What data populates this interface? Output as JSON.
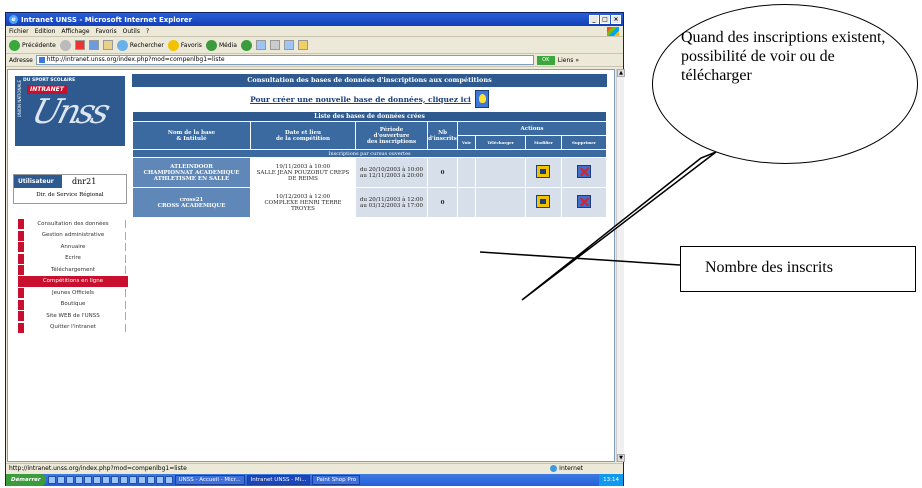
{
  "window": {
    "title": "Intranet UNSS - Microsoft Internet Explorer",
    "controls": [
      "_",
      "□",
      "×"
    ]
  },
  "menu": [
    "Fichier",
    "Edition",
    "Affichage",
    "Favoris",
    "Outils",
    "?"
  ],
  "toolbar": {
    "back": "Précédente",
    "search": "Rechercher",
    "favorites": "Favoris",
    "media": "Média"
  },
  "address": {
    "label": "Adresse",
    "url": "http://intranet.unss.org/index.php?mod=compenlbg1=liste",
    "go": "OK",
    "links": "Liens »"
  },
  "logo": {
    "top_text": "DU SPORT SCOLAIRE",
    "banner": "INTRANET",
    "side_text": "UNION NATIONALE",
    "script": "Unss"
  },
  "user": {
    "label": "Utilisateur",
    "name": "dnr21",
    "role": "Dir. de Service Régional"
  },
  "nav": [
    {
      "label": "Consultation des données",
      "active": false
    },
    {
      "label": "Gestion administrative",
      "active": false
    },
    {
      "label": "Annuaire",
      "active": false
    },
    {
      "label": "Ecrire",
      "active": false
    },
    {
      "label": "Téléchargement",
      "active": false
    },
    {
      "label": "Compétitions en ligne",
      "active": true
    },
    {
      "label": "Jeunes Officiels",
      "active": false
    },
    {
      "label": "Boutique",
      "active": false
    },
    {
      "label": "Site WEB de l'UNSS",
      "active": false
    },
    {
      "label": "Quitter l'intranet",
      "active": false
    }
  ],
  "main": {
    "banner": "Consultation des bases de données d'inscriptions aux compétitions",
    "create_link": "Pour créer une nouvelle base de données, cliquez ici",
    "list_title": "Liste des bases de données crées",
    "headers": {
      "name": [
        "Nom de la base",
        "& Intitulé"
      ],
      "date": [
        "Date et lieu",
        "de la compétition"
      ],
      "period": [
        "Période",
        "d'ouverture",
        "des inscriptions"
      ],
      "nb": [
        "Nb",
        "d'inscrits"
      ],
      "actions": "Actions",
      "action_cols": [
        "Voir",
        "Télécharger",
        "Modifier",
        "Supprimer"
      ]
    },
    "group_label": "Inscriptions par cursus ouvertes",
    "rows": [
      {
        "name": [
          "ATLEINDOOR",
          "CHAMPIONNAT ACADEMIQUE",
          "ATHLETISME EN SALLE"
        ],
        "date": [
          "19/11/2003 à 10:00",
          "SALLE JEAN POUZOBUT CREPS",
          "DE REIMS"
        ],
        "period": [
          "du 20/10/2003 à 10:00",
          "au 12/11/2003 à 20:00"
        ],
        "nb": "0"
      },
      {
        "name": [
          "cross21",
          "CROSS ACADEMIQUE"
        ],
        "date": [
          "10/12/2003 à 12:00",
          "COMPLEXE HENRI TERRE",
          "TROYES"
        ],
        "period": [
          "du 20/11/2003 à 12:00",
          "au 03/12/2003 à 17:00"
        ],
        "nb": "0"
      }
    ]
  },
  "status": {
    "url": "http://intranet.unss.org/index.php?mod=compenlbg1=liste",
    "zone": "Internet"
  },
  "taskbar": {
    "start": "Démarrer",
    "tasks": [
      "UNSS - Accueil - Micr...",
      "Intranet UNSS - Mi...",
      "Paint Shop Pro"
    ],
    "clock": "13:14"
  },
  "callouts": {
    "actions_note": "Quand des inscriptions existent, possibilité de voir ou de télécharger",
    "count_note": "Nombre des inscrits"
  }
}
